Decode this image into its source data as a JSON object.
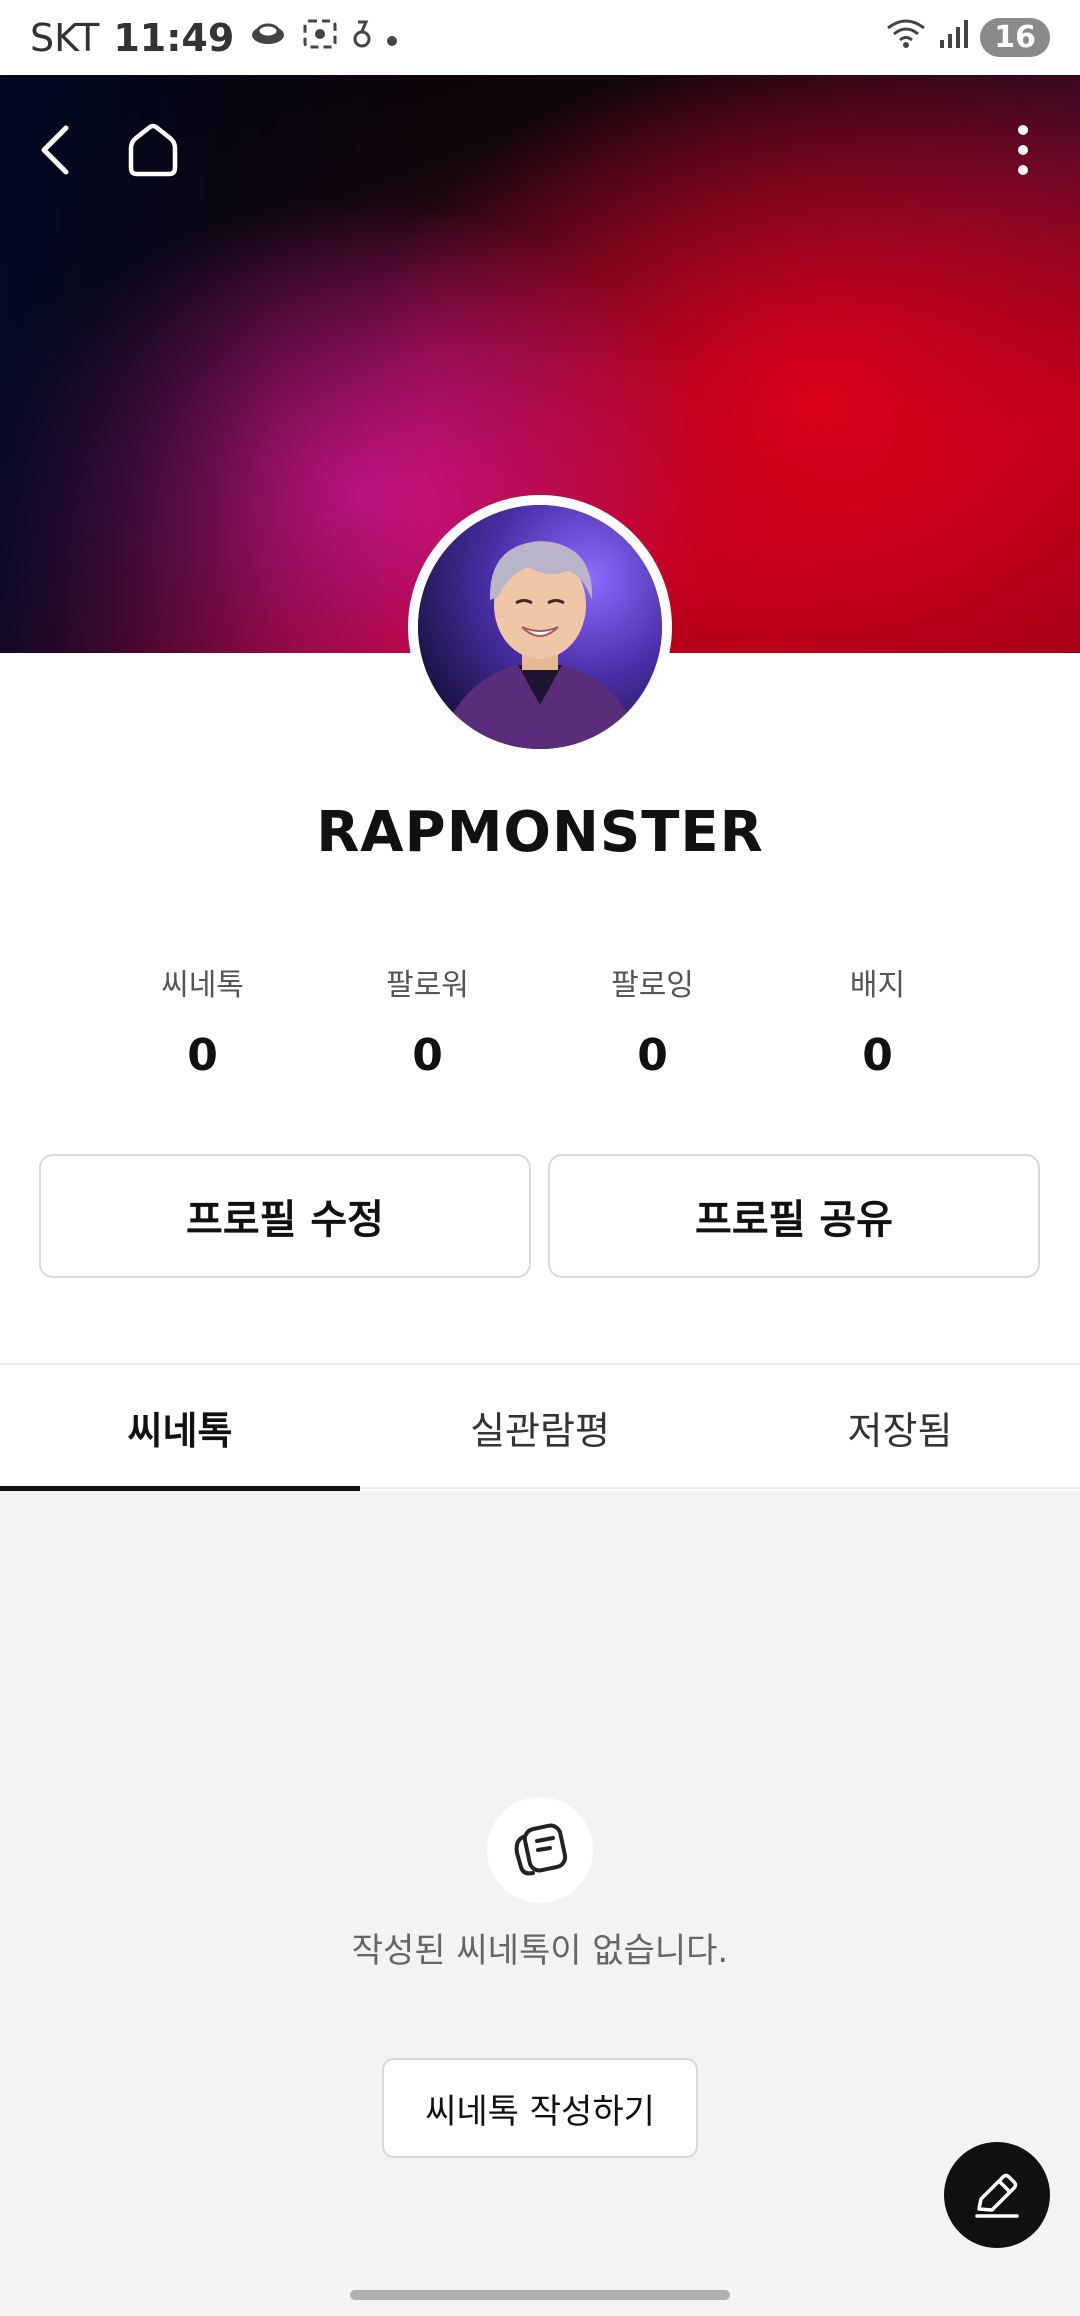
{
  "status_bar": {
    "carrier": "SKT",
    "time": "11:49",
    "battery": "16"
  },
  "header": {
    "back_icon": "chevron-left-icon",
    "home_icon": "home-icon",
    "more_icon": "more-vertical-icon"
  },
  "profile": {
    "username": "RAPMONSTER",
    "stats": [
      {
        "label": "씨네톡",
        "value": "0"
      },
      {
        "label": "팔로워",
        "value": "0"
      },
      {
        "label": "팔로잉",
        "value": "0"
      },
      {
        "label": "배지",
        "value": "0"
      }
    ],
    "edit_label": "프로필 수정",
    "share_label": "프로필 공유"
  },
  "tabs": [
    {
      "label": "씨네톡",
      "active": true
    },
    {
      "label": "실관람평",
      "active": false
    },
    {
      "label": "저장됨",
      "active": false
    }
  ],
  "empty_state": {
    "icon": "chat-bubbles-icon",
    "message": "작성된 씨네톡이 없습니다.",
    "button_label": "씨네톡 작성하기"
  },
  "fab": {
    "icon": "pencil-icon"
  }
}
